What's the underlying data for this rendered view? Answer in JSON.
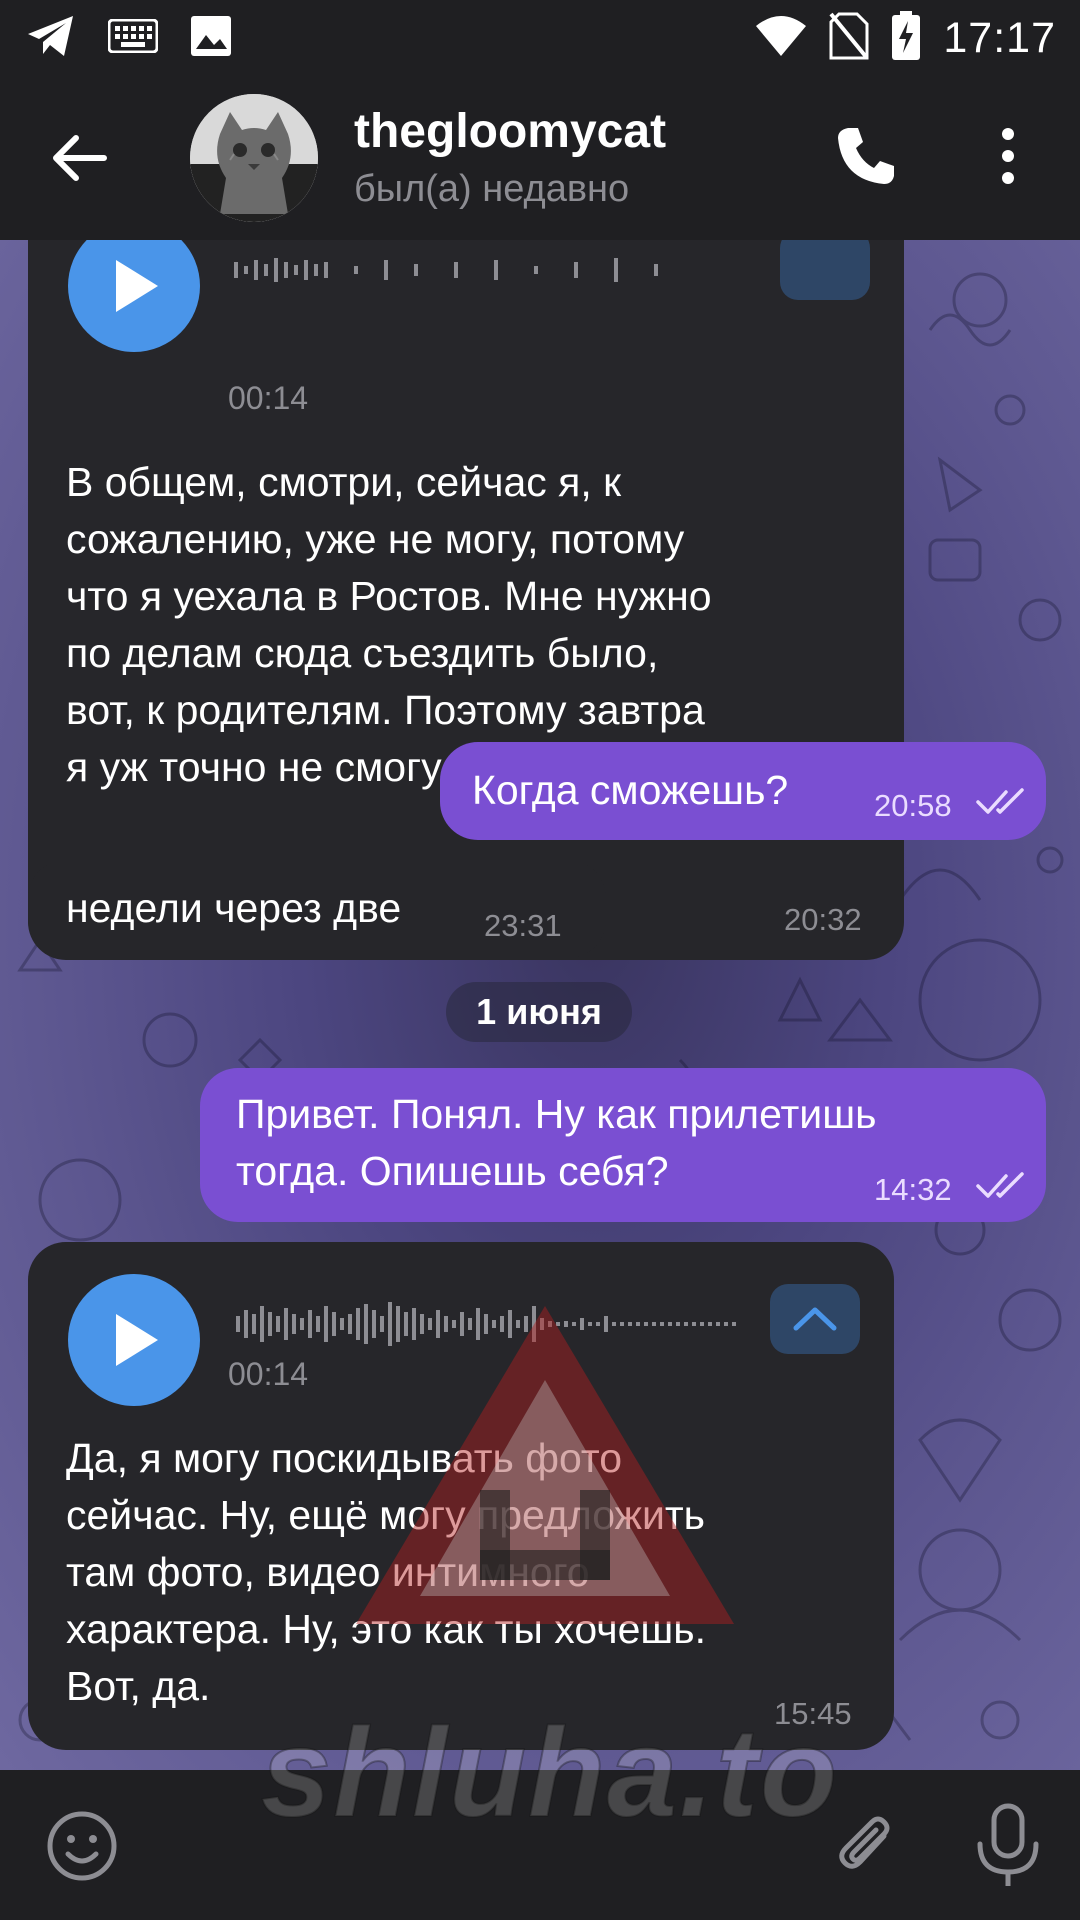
{
  "status_bar": {
    "time": "17:17",
    "icons": [
      "telegram-icon",
      "keyboard-icon",
      "image-icon",
      "wifi-icon",
      "no-sim-icon",
      "battery-charging-icon"
    ]
  },
  "header": {
    "contact_name": "thegloomycat",
    "status": "был(а) недавно",
    "icons": [
      "back-arrow-icon",
      "phone-icon",
      "more-vert-icon"
    ]
  },
  "messages": [
    {
      "direction": "in",
      "type": "voice",
      "duration": "00:14",
      "transcript": "В общем, смотри, сейчас я, к сожалению, уже не могу, потому что я уехала в Ростов. Мне нужно по делам сюда съездить было, вот, к родителям. Поэтому завтра я уж точно не смогу.",
      "transcript_lines": [
        "В общем, смотри, сейчас я, к",
        "сожалению, уже не могу, потому",
        "что я уехала в Ростов. Мне нужно",
        "по делам сюда съездить было,",
        "вот, к родителям. Поэтому завтра",
        "я уж точно не смогу."
      ],
      "time": "20:32"
    },
    {
      "direction": "out",
      "type": "text",
      "text": "Когда сможешь?",
      "time": "20:58",
      "read": true
    },
    {
      "direction": "in",
      "type": "text",
      "text": "недели через две",
      "time": "23:31"
    },
    {
      "type": "date",
      "text": "1 июня"
    },
    {
      "direction": "out",
      "type": "text",
      "text": "Привет. Понял. Ну как прилетишь тогда. Опишешь себя?",
      "lines": [
        "Привет. Понял. Ну как прилетишь",
        "тогда. Опишешь себя?"
      ],
      "time": "14:32",
      "read": true
    },
    {
      "direction": "in",
      "type": "voice",
      "duration": "00:14",
      "transcript": "Да, я могу поскидывать фото сейчас. Ну, ещё могу предложить там фото, видео интимного характера. Ну, это как ты хочешь. Вот, да.",
      "transcript_lines": [
        "Да, я могу поскидывать фото",
        "сейчас. Ну, ещё могу предложить",
        "там фото, видео интимного",
        "характера. Ну, это как ты хочешь.",
        "Вот, да."
      ],
      "time": "15:45"
    }
  ],
  "input_bar": {
    "icons": [
      "emoji-icon",
      "attach-icon",
      "microphone-icon"
    ]
  },
  "watermark": {
    "text": "shluha.to"
  },
  "colors": {
    "incoming_bubble": "#26262a",
    "outgoing_bubble": "#7a4fd2",
    "play_button": "#4a95e9",
    "bar_background": "#1f1f22",
    "secondary_text": "#8d8d93"
  }
}
